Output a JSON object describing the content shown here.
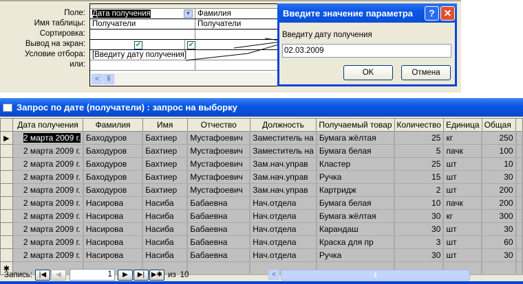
{
  "design": {
    "labels": [
      "Поле:",
      "Имя таблицы:",
      "Сортировка:",
      "Вывод на экран:",
      "Условие отбора:",
      "или:"
    ],
    "columns": [
      {
        "field": "Дата получения",
        "table": "Получатели",
        "criteria": "[Введиту дату получения]"
      },
      {
        "field": "Фамилия",
        "table": "Получатели",
        "criteria": ""
      }
    ]
  },
  "dialog": {
    "title": "Введите значение параметра",
    "help": "?",
    "close": "✕",
    "prompt": "Введиту дату получения",
    "value": "02.03.2009",
    "ok": "OK",
    "cancel": "Отмена"
  },
  "datasheet": {
    "title": "Запрос по дате (получатели) : запрос на выборку",
    "headers": [
      "Дата получения",
      "Фамилия",
      "Имя",
      "Отчество",
      "Должность",
      "Получаемый товар",
      "Количество",
      "Единица",
      "Общая"
    ],
    "rows": [
      [
        "2 марта 2009 г.",
        "Баходуров",
        "Бахтиер",
        "Мустафоевич",
        "Заместитель на",
        "Бумага жёлтая",
        "25",
        "кг",
        "250"
      ],
      [
        "2 марта 2009 г.",
        "Баходуров",
        "Бахтиер",
        "Мустафоевич",
        "Заместитель на",
        "Бумага белая",
        "5",
        "пачк",
        "100"
      ],
      [
        "2 марта 2009 г.",
        "Баходуров",
        "Бахтиер",
        "Мустафоевич",
        "Зам.нач.управ",
        "Кластер",
        "25",
        "шт",
        "10"
      ],
      [
        "2 марта 2009 г.",
        "Баходуров",
        "Бахтиер",
        "Мустафоевич",
        "Зам.нач.управ",
        "Ручка",
        "15",
        "шт",
        "30"
      ],
      [
        "2 марта 2009 г.",
        "Баходуров",
        "Бахтиер",
        "Мустафоевич",
        "Зам.нач.управ",
        "Картридж",
        "2",
        "шт",
        "200"
      ],
      [
        "2 марта 2009 г.",
        "Насирова",
        "Насиба",
        "Бабаевна",
        "Нач.отдела",
        "Бумага белая",
        "10",
        "пачк",
        "200"
      ],
      [
        "2 марта 2009 г.",
        "Насирова",
        "Насиба",
        "Бабаевна",
        "Нач.отдела",
        "Бумага жёлтая",
        "30",
        "кг",
        "300"
      ],
      [
        "2 марта 2009 г.",
        "Насирова",
        "Насиба",
        "Бабаевна",
        "Нач.отдела",
        "Карандаш",
        "30",
        "шт",
        "30"
      ],
      [
        "2 марта 2009 г.",
        "Насирова",
        "Насиба",
        "Бабаевна",
        "Нач.отдела",
        "Краска для пр",
        "3",
        "шт",
        "60"
      ],
      [
        "2 марта 2009 г.",
        "Насирова",
        "Насиба",
        "Бабаевна",
        "Нач.отдела",
        "Ручка",
        "30",
        "шт",
        "30"
      ]
    ],
    "nav": {
      "label": "Запись:",
      "current": "1",
      "of": "из",
      "total": "10"
    }
  }
}
